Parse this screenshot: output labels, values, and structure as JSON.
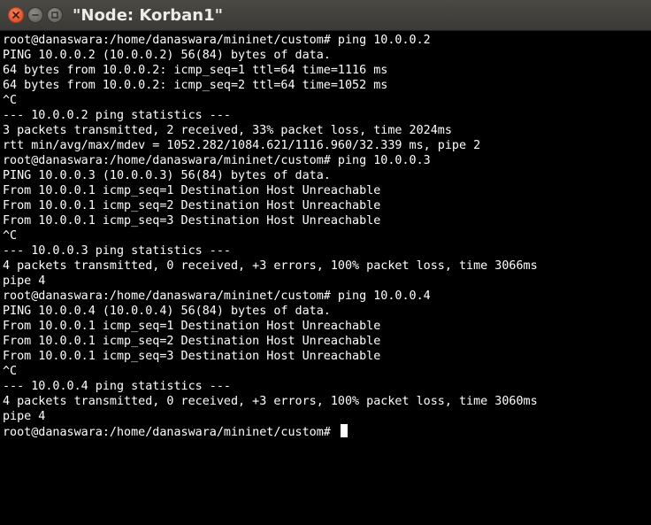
{
  "window": {
    "title": "\"Node: Korban1\""
  },
  "terminal": {
    "lines": [
      "root@danaswara:/home/danaswara/mininet/custom# ping 10.0.0.2",
      "PING 10.0.0.2 (10.0.0.2) 56(84) bytes of data.",
      "64 bytes from 10.0.0.2: icmp_seq=1 ttl=64 time=1116 ms",
      "64 bytes from 10.0.0.2: icmp_seq=2 ttl=64 time=1052 ms",
      "^C",
      "--- 10.0.0.2 ping statistics ---",
      "3 packets transmitted, 2 received, 33% packet loss, time 2024ms",
      "rtt min/avg/max/mdev = 1052.282/1084.621/1116.960/32.339 ms, pipe 2",
      "root@danaswara:/home/danaswara/mininet/custom# ping 10.0.0.3",
      "PING 10.0.0.3 (10.0.0.3) 56(84) bytes of data.",
      "From 10.0.0.1 icmp_seq=1 Destination Host Unreachable",
      "From 10.0.0.1 icmp_seq=2 Destination Host Unreachable",
      "From 10.0.0.1 icmp_seq=3 Destination Host Unreachable",
      "^C",
      "--- 10.0.0.3 ping statistics ---",
      "4 packets transmitted, 0 received, +3 errors, 100% packet loss, time 3066ms",
      "pipe 4",
      "root@danaswara:/home/danaswara/mininet/custom# ping 10.0.0.4",
      "PING 10.0.0.4 (10.0.0.4) 56(84) bytes of data.",
      "From 10.0.0.1 icmp_seq=1 Destination Host Unreachable",
      "From 10.0.0.1 icmp_seq=2 Destination Host Unreachable",
      "From 10.0.0.1 icmp_seq=3 Destination Host Unreachable",
      "^C",
      "--- 10.0.0.4 ping statistics ---",
      "4 packets transmitted, 0 received, +3 errors, 100% packet loss, time 3060ms",
      "pipe 4"
    ],
    "prompt": "root@danaswara:/home/danaswara/mininet/custom# "
  },
  "colors": {
    "background": "#000000",
    "foreground": "#ffffff",
    "titlebar": "#3c3b37",
    "close_button": "#e95420"
  },
  "icons": {
    "close": "close-icon",
    "minimize": "minimize-icon",
    "maximize": "maximize-icon"
  }
}
